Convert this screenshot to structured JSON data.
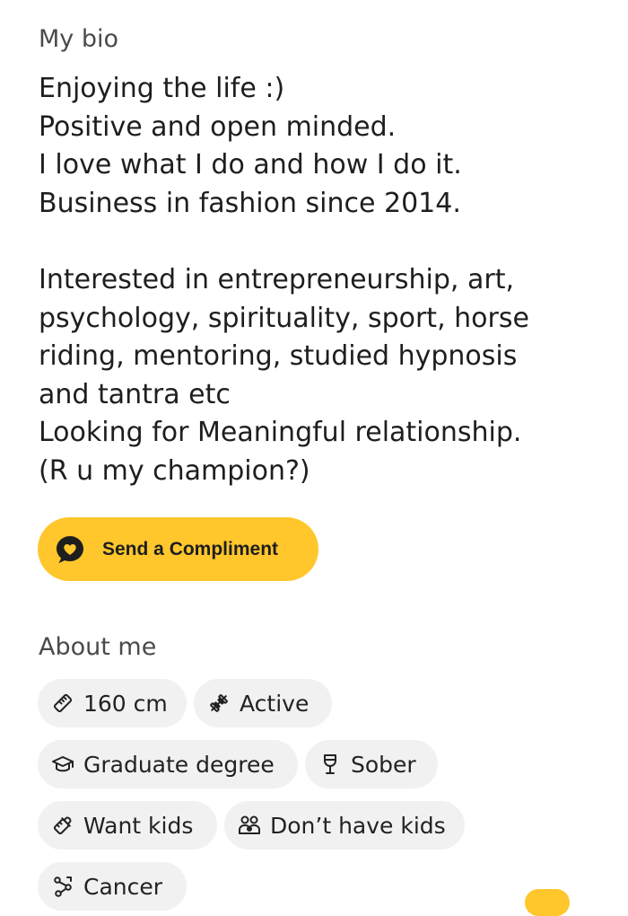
{
  "bio": {
    "title": "My bio",
    "lines": [
      "Enjoying the life :)",
      "Positive and open minded.",
      "I love what I do and how I do it.",
      "Business in fashion since 2014.",
      "",
      "Interested in entrepreneurship, art,",
      "psychology, spirituality, sport, horse",
      "riding, mentoring, studied hypnosis",
      "and tantra etc",
      "Looking for Meaningful relationship.",
      "(R u my champion?)"
    ]
  },
  "compliment_button": {
    "label": "Send a Compliment",
    "icon": "heart-speech-bubble-icon"
  },
  "about": {
    "title": "About me",
    "chips": [
      {
        "label": "160 cm",
        "icon": "ruler-icon"
      },
      {
        "label": "Active",
        "icon": "dumbbell-icon"
      },
      {
        "label": "Graduate degree",
        "icon": "graduation-cap-icon"
      },
      {
        "label": "Sober",
        "icon": "wine-glass-icon"
      },
      {
        "label": "Want kids",
        "icon": "baby-bottle-icon"
      },
      {
        "label": "Don’t have kids",
        "icon": "family-icon"
      },
      {
        "label": "Cancer",
        "icon": "zodiac-cancer-icon"
      }
    ]
  },
  "colors": {
    "accent": "#ffc72c",
    "chip_background": "#f1f1f1",
    "text": "#1e1e1e"
  }
}
